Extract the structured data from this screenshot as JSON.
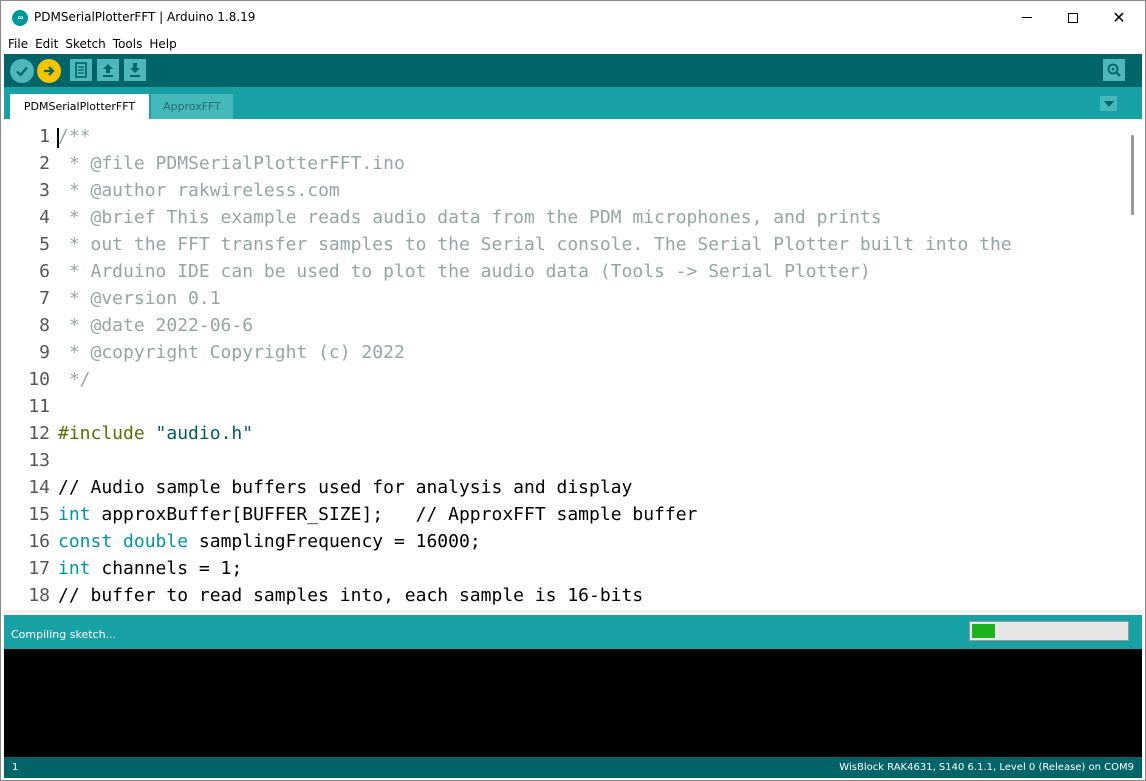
{
  "window": {
    "title": "PDMSerialPlotterFFT | Arduino 1.8.19",
    "app_icon_text": "∞",
    "close_glyph": "✕"
  },
  "menu": [
    "File",
    "Edit",
    "Sketch",
    "Tools",
    "Help"
  ],
  "toolbar": {
    "buttons": [
      "verify-icon",
      "upload-icon",
      "new-icon",
      "open-icon",
      "save-icon",
      "serial-monitor-icon"
    ]
  },
  "tabs": [
    {
      "label": "PDMSerialPlotterFFT",
      "active": true
    },
    {
      "label": "ApproxFFT",
      "active": false
    }
  ],
  "editor": {
    "lines": [
      {
        "n": "1"
      },
      {
        "n": "2"
      },
      {
        "n": "3"
      },
      {
        "n": "4"
      },
      {
        "n": "5"
      },
      {
        "n": "6"
      },
      {
        "n": "7"
      },
      {
        "n": "8"
      },
      {
        "n": "9"
      },
      {
        "n": "10"
      },
      {
        "n": "11"
      },
      {
        "n": "12"
      },
      {
        "n": "13"
      },
      {
        "n": "14"
      },
      {
        "n": "15"
      },
      {
        "n": "16"
      },
      {
        "n": "17"
      },
      {
        "n": "18"
      }
    ],
    "code": {
      "l1": "/**",
      "l2": " * @file PDMSerialPlotterFFT.ino",
      "l3": " * @author rakwireless.com",
      "l4": " * @brief This example reads audio data from the PDM microphones, and prints",
      "l5": " * out the FFT transfer samples to the Serial console. The Serial Plotter built into the",
      "l6": " * Arduino IDE can be used to plot the audio data (Tools -> Serial Plotter)",
      "l7": " * @version 0.1",
      "l8": " * @date 2022-06-6",
      "l9": " * @copyright Copyright (c) 2022",
      "l10": " */",
      "l11": "",
      "l12_pp": "#include",
      "l12_str": "\"audio.h\"",
      "l13": "",
      "l14": "// Audio sample buffers used for analysis and display",
      "l15_kw": "int",
      "l15_rest": " approxBuffer[BUFFER_SIZE];   ",
      "l15_cmt": "// ApproxFFT sample buffer",
      "l16_kw1": "const",
      "l16_kw2": "double",
      "l16_rest": " samplingFrequency = 16000;",
      "l17_kw": "int",
      "l17_rest": " channels = 1;",
      "l18": "// buffer to read samples into, each sample is 16-bits"
    }
  },
  "status": {
    "text": "Compiling sketch...",
    "progress": 0.15
  },
  "footer": {
    "line": "1",
    "board": "WisBlock RAK4631, S140 6.1.1, Level 0 (Release) on COM9"
  },
  "colors": {
    "toolbar": "#006468",
    "tabbar": "#17a1a5",
    "keyword": "#00979c",
    "comment": "#95a5a6",
    "progress": "#1eb01e"
  }
}
